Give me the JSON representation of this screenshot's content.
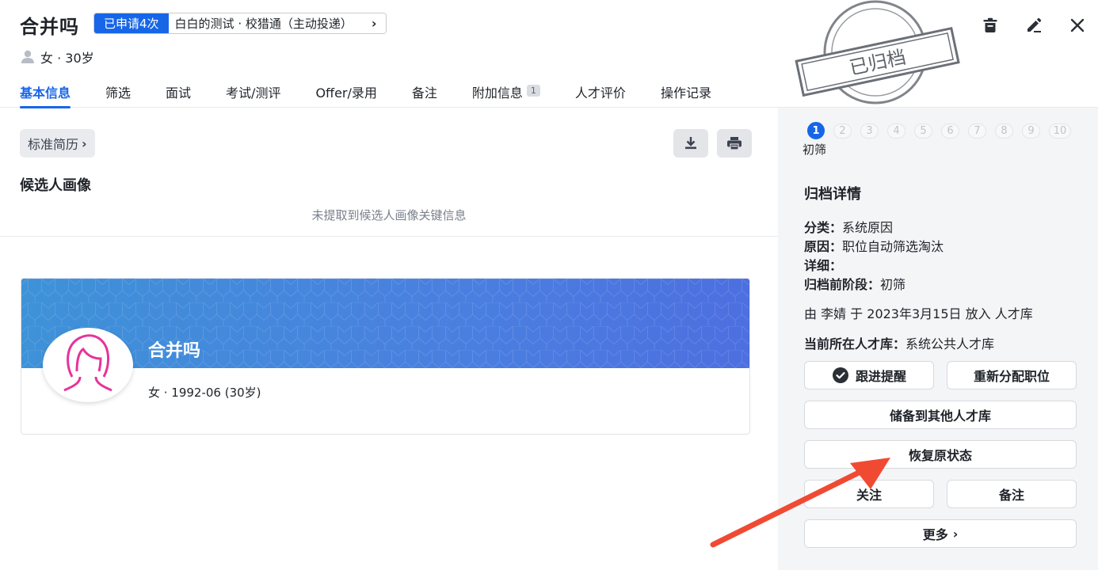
{
  "header": {
    "candidate_name": "合并吗",
    "apply_count": "已申请4次",
    "apply_source": "白白的测试 · 校猎通（主动投递）",
    "profile": "女 · 30岁",
    "stamp_text": "已归档"
  },
  "tabs": [
    {
      "label": "基本信息",
      "active": true
    },
    {
      "label": "筛选"
    },
    {
      "label": "面试"
    },
    {
      "label": "考试/测评"
    },
    {
      "label": "Offer/录用"
    },
    {
      "label": "备注"
    },
    {
      "label": "附加信息",
      "badge": "1"
    },
    {
      "label": "人才评价"
    },
    {
      "label": "操作记录"
    }
  ],
  "icons": {
    "delete": "trash-icon",
    "edit": "pencil-icon",
    "close": "close-icon",
    "download": "download-icon",
    "print": "printer-icon"
  },
  "main": {
    "resume_button": "标准简历",
    "portrait_title": "候选人画像",
    "portrait_empty": "未提取到候选人画像关键信息",
    "card": {
      "name": "合并吗",
      "info": "女 · 1992-06 (30岁)"
    }
  },
  "side": {
    "steps": [
      "1",
      "2",
      "3",
      "4",
      "5",
      "6",
      "7",
      "8",
      "9",
      "10"
    ],
    "current_step": 1,
    "current_stage": "初筛",
    "title": "归档详情",
    "category_key": "分类：",
    "category_val": "系统原因",
    "reason_key": "原因：",
    "reason_val": "职位自动筛选淘汰",
    "detail_key": "详细：",
    "prev_stage_key": "归档前阶段：",
    "prev_stage_val": "初筛",
    "placed_by": "由 李婧 于 2023年3月15日 放入 人才库",
    "current_pool_key": "当前所在人才库：",
    "current_pool_val": "系统公共人才库",
    "buttons": {
      "follow_reminder": "跟进提醒",
      "reassign": "重新分配职位",
      "save_to_other": "储备到其他人才库",
      "restore": "恢复原状态",
      "follow": "关注",
      "note": "备注",
      "more": "更多"
    }
  },
  "colors": {
    "primary": "#1766e8",
    "arrow": "#f04a33",
    "side_bg": "#f4f5f7"
  }
}
